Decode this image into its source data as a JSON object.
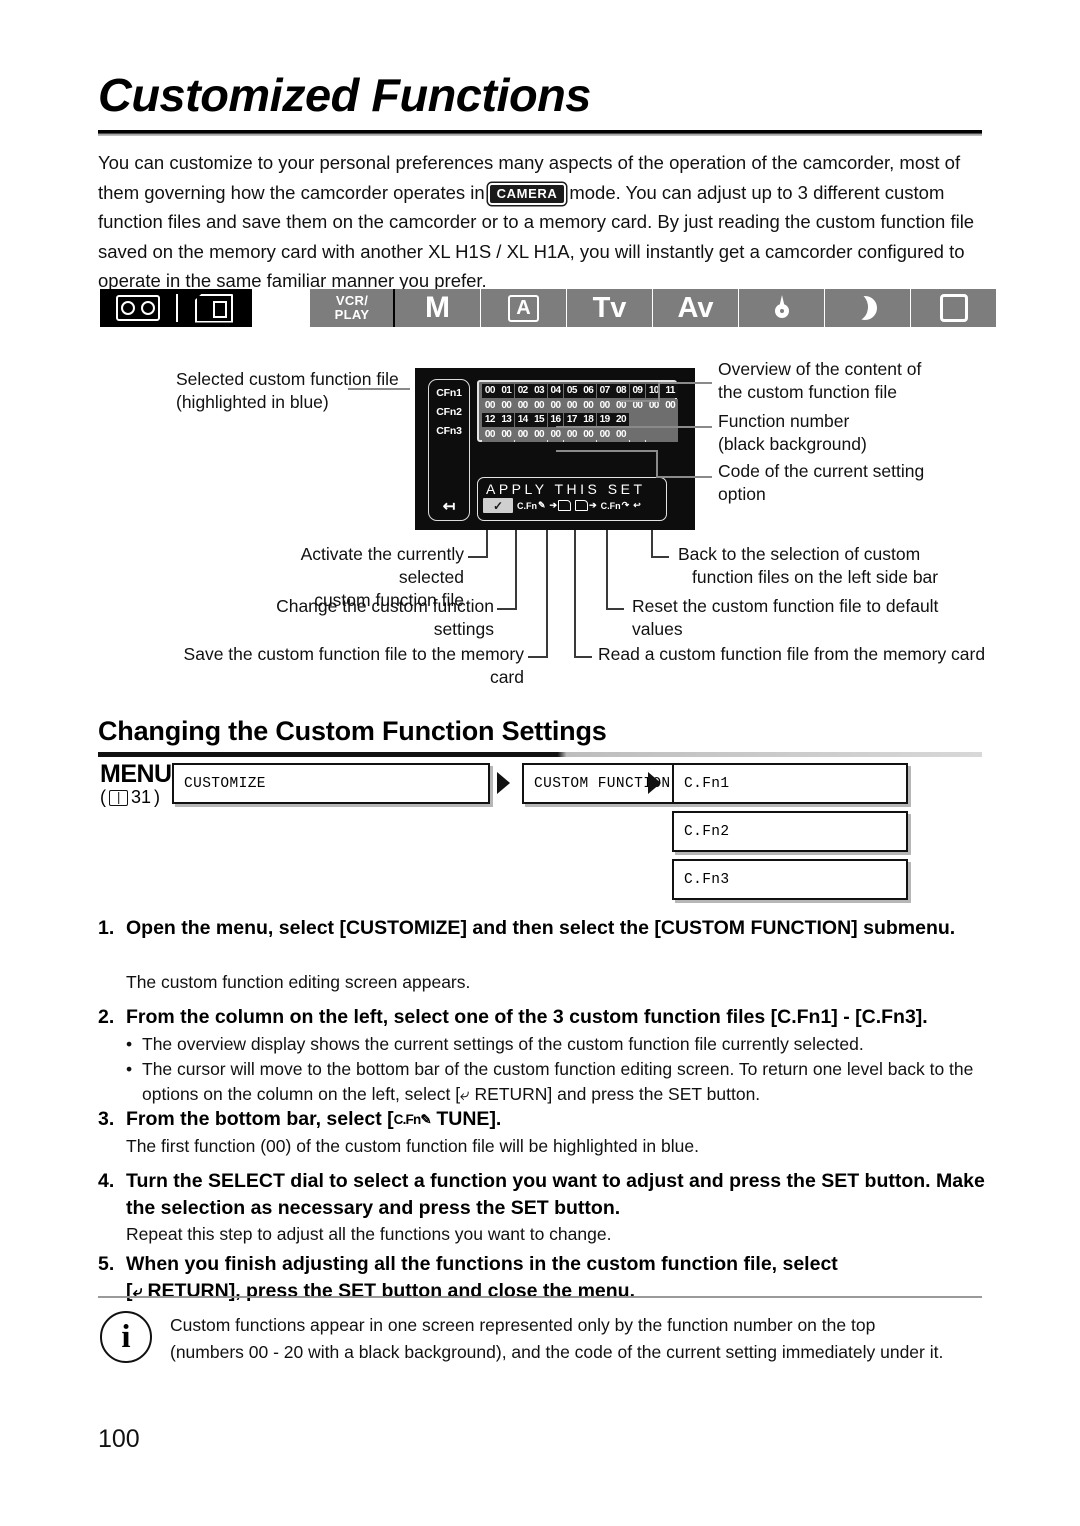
{
  "page": {
    "title": "Customized Functions",
    "number": "100"
  },
  "intro": {
    "part1": "You can customize to your personal preferences many aspects of the operation of the camcorder, most of them governing how the camcorder operates in",
    "badge": "CAMERA",
    "part2": "mode. You can adjust up to 3 different custom function files and save them on the camcorder or to a memory card. By just reading the custom function file saved on the memory card with another XL H1S / XL H1A, you will instantly get a camcorder configured to operate in the same familiar manner you prefer."
  },
  "media_bar": {
    "items": [
      {
        "icon": "tape-icon",
        "label": "Tape"
      },
      {
        "icon": "memory-card-icon",
        "label": "Card"
      }
    ]
  },
  "mode_bar": {
    "items": [
      {
        "label": "VCR/\nPLAY",
        "line1": "VCR/",
        "line2": "PLAY",
        "icon": "vcr-play-mode"
      },
      {
        "label": "M",
        "icon": "manual-mode"
      },
      {
        "label": "A",
        "icon": "auto-mode"
      },
      {
        "label": "Tv",
        "icon": "shutter-priority-mode"
      },
      {
        "label": "Av",
        "icon": "aperture-priority-mode"
      },
      {
        "label": "",
        "icon": "spotlight-mode"
      },
      {
        "label": "",
        "icon": "night-mode"
      },
      {
        "label": "",
        "icon": "easy-recording-mode"
      }
    ]
  },
  "figure": {
    "screen": {
      "side_bar": {
        "items": [
          "CFn1",
          "CFn2",
          "CFn3"
        ],
        "selected": "CFn1",
        "return_icon": "return-arrow-icon"
      },
      "overview": {
        "row1_numbers": [
          "00",
          "01",
          "02",
          "03",
          "04",
          "05",
          "06",
          "07",
          "08",
          "09",
          "10",
          "11"
        ],
        "row1_values": [
          "00",
          "00",
          "00",
          "00",
          "00",
          "00",
          "00",
          "00",
          "00",
          "00",
          "00",
          "00"
        ],
        "row2_numbers": [
          "12",
          "13",
          "14",
          "15",
          "16",
          "17",
          "18",
          "19",
          "20"
        ],
        "row2_values": [
          "00",
          "00",
          "00",
          "00",
          "00",
          "00",
          "00",
          "00",
          "00"
        ]
      },
      "bottom_panel": {
        "title": "APPLY THIS SET",
        "icons": [
          {
            "name": "apply-check-icon",
            "glyph": "✓",
            "selected": true
          },
          {
            "name": "cfn-tune-icon",
            "text": "C.Fn"
          },
          {
            "name": "save-to-card-icon",
            "text": ""
          },
          {
            "name": "read-from-card-icon",
            "text": ""
          },
          {
            "name": "cfn-reset-icon",
            "text": "C.Fn"
          },
          {
            "name": "return-icon",
            "text": ""
          }
        ]
      }
    },
    "labels": {
      "selected_file": "Selected custom function file\n(highlighted in blue)",
      "selected_file_l1": "Selected custom function file",
      "selected_file_l2": "(highlighted in blue)",
      "overview_l1": "Overview of the content of",
      "overview_l2": "the custom function file",
      "function_number_l1": "Function number",
      "function_number_l2": "(black background)",
      "code_l1": "Code of the current setting",
      "code_l2": "option",
      "activate_l1": "Activate the currently selected",
      "activate_l2": "custom function file",
      "change_settings": "Change the custom function settings",
      "save_card": "Save the custom function file to the memory card",
      "back_l1": "Back to the selection of custom",
      "back_l2": "function files on the left side bar",
      "reset_l1": "Reset the custom function file to default",
      "reset_l2": "values",
      "read_card": "Read a custom function file from the memory card"
    }
  },
  "section": {
    "heading": "Changing the Custom Function Settings",
    "menu_label": "MENU",
    "menu_ref_open": "(",
    "menu_ref_page": "31",
    "menu_ref_close": ")",
    "flow": {
      "box1": "CUSTOMIZE",
      "box2": "CUSTOM FUNCTION",
      "box3a": "C.Fn1",
      "box3b": "C.Fn2",
      "box3c": "C.Fn3"
    }
  },
  "steps": [
    {
      "num": "1.",
      "text": "Open the menu, select [CUSTOMIZE] and then select the [CUSTOM FUNCTION] submenu.",
      "sub": "The custom function editing screen appears."
    },
    {
      "num": "2.",
      "text": "From the column on the left, select one of the 3 custom function files [C.Fn1] - [C.Fn3].",
      "bullets": [
        "The overview display shows the current settings of the custom function file currently selected.",
        "The cursor will move to the bottom bar of the custom function editing screen. To return one level back to the options on the column on the left, select [",
        " RETURN] and press the SET button."
      ]
    },
    {
      "num": "3.",
      "text_before": "From the bottom bar, select [",
      "cfn_glyph": "C.Fn",
      "text_after": " TUNE].",
      "sub": "The first function (00) of the custom function file will be highlighted in blue."
    },
    {
      "num": "4.",
      "text": "Turn the SELECT dial to select a function you want to adjust and press the SET button. Make the selection as necessary and press the SET button.",
      "sub": "Repeat this step to adjust all the functions you want to change."
    },
    {
      "num": "5.",
      "text_l1": "When you finish adjusting all the functions in the custom function file, select",
      "text_l2_before": "[",
      "text_l2_after": " RETURN], press the SET button and close the menu."
    }
  ],
  "note": {
    "icon": "info-icon",
    "icon_glyph": "i",
    "line1": "Custom functions appear in one screen represented only by the function number on the top",
    "line2": "(numbers 00 - 20 with a black background), and the code of the current setting immediately under it."
  }
}
